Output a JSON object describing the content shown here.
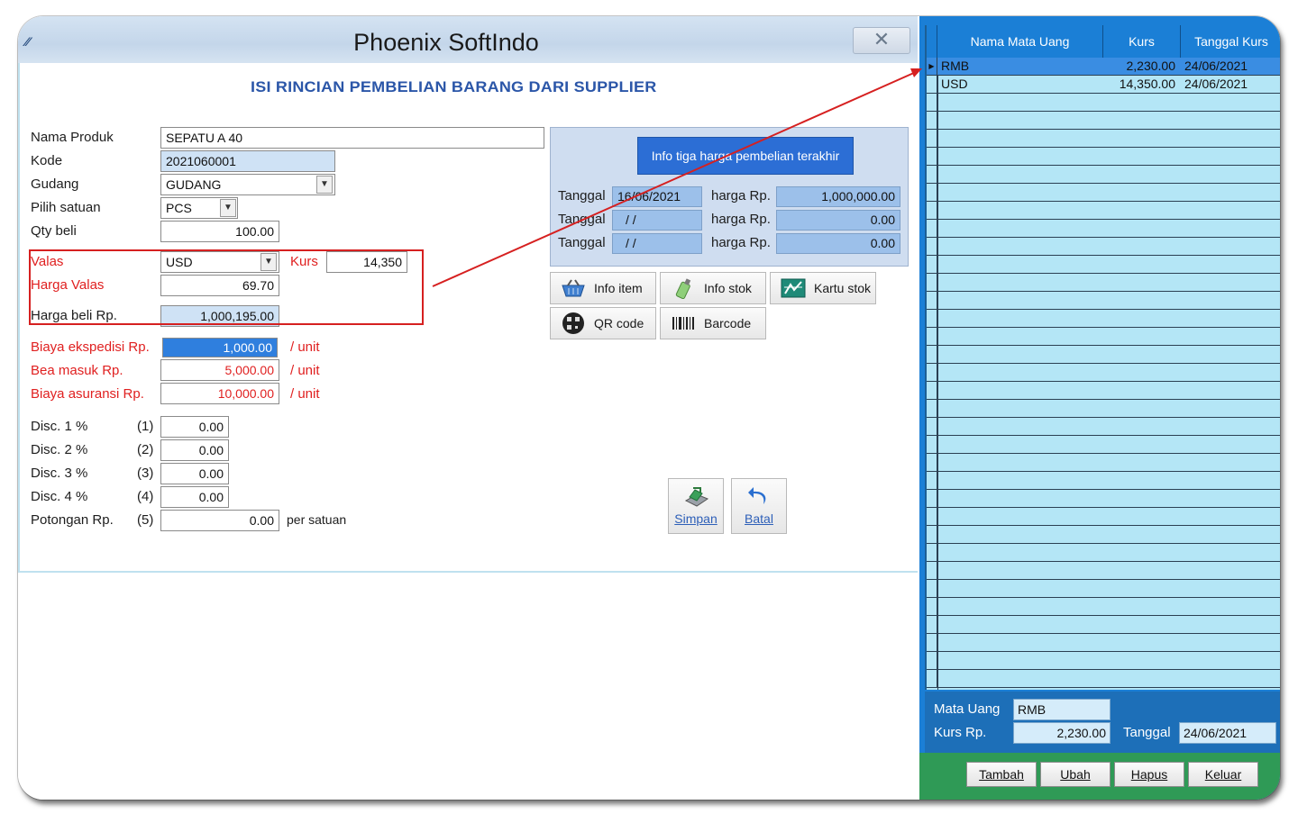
{
  "window": {
    "title": "Phoenix SoftIndo",
    "heading": "ISI RINCIAN PEMBELIAN BARANG DARI SUPPLIER"
  },
  "form": {
    "nama_produk": {
      "label": "Nama Produk",
      "value": "SEPATU A 40"
    },
    "kode": {
      "label": "Kode",
      "value": "2021060001"
    },
    "gudang": {
      "label": "Gudang",
      "value": "GUDANG"
    },
    "satuan": {
      "label": "Pilih satuan",
      "value": "PCS"
    },
    "qty": {
      "label": "Qty beli",
      "value": "100.00"
    },
    "valas": {
      "label": "Valas",
      "value": "USD"
    },
    "kurs": {
      "label": "Kurs",
      "value": "14,350"
    },
    "harga_valas": {
      "label": "Harga Valas",
      "value": "69.70"
    },
    "harga_beli": {
      "label": "Harga beli Rp.",
      "value": "1,000,195.00"
    },
    "biaya_ekspedisi": {
      "label": "Biaya ekspedisi Rp.",
      "value": "1,000.00",
      "unit": "/ unit"
    },
    "bea_masuk": {
      "label": "Bea masuk Rp.",
      "value": "5,000.00",
      "unit": "/ unit"
    },
    "biaya_asuransi": {
      "label": "Biaya asuransi Rp.",
      "value": "10,000.00",
      "unit": "/ unit"
    },
    "discounts": [
      {
        "label": "Disc. 1 %",
        "num": "(1)",
        "value": "0.00"
      },
      {
        "label": "Disc. 2 %",
        "num": "(2)",
        "value": "0.00"
      },
      {
        "label": "Disc. 3 %",
        "num": "(3)",
        "value": "0.00"
      },
      {
        "label": "Disc. 4 %",
        "num": "(4)",
        "value": "0.00"
      }
    ],
    "potongan": {
      "label": "Potongan Rp.",
      "num": "(5)",
      "value": "0.00",
      "unit": "per satuan"
    }
  },
  "info_panel": {
    "button_label": "Info tiga harga pembelian terakhir",
    "rows": [
      {
        "tanggal_label": "Tanggal",
        "tanggal": "16/06/2021",
        "harga_label": "harga Rp.",
        "harga": "1,000,000.00"
      },
      {
        "tanggal_label": "Tanggal",
        "tanggal": "/ /",
        "harga_label": "harga Rp.",
        "harga": "0.00"
      },
      {
        "tanggal_label": "Tanggal",
        "tanggal": "/ /",
        "harga_label": "harga Rp.",
        "harga": "0.00"
      }
    ]
  },
  "tool_buttons": {
    "info_item": "Info item",
    "info_stok": "Info stok",
    "kartu_stok": "Kartu stok",
    "qr_code": "QR code",
    "barcode": "Barcode"
  },
  "actions": {
    "simpan": "Simpan",
    "batal": "Batal"
  },
  "currency_grid": {
    "columns": [
      "Nama Mata Uang",
      "Kurs",
      "Tanggal Kurs"
    ],
    "rows": [
      {
        "nama": "RMB",
        "kurs": "2,230.00",
        "tanggal": "24/06/2021"
      },
      {
        "nama": "USD",
        "kurs": "14,350.00",
        "tanggal": "24/06/2021"
      }
    ],
    "indicator": "▶"
  },
  "currency_detail": {
    "mata_uang_label": "Mata Uang",
    "mata_uang": "RMB",
    "kurs_label": "Kurs Rp.",
    "kurs": "2,230.00",
    "tanggal_label": "Tanggal",
    "tanggal": "24/06/2021"
  },
  "footer_buttons": {
    "tambah": "Tambah",
    "ubah": "Ubah",
    "hapus": "Hapus",
    "keluar": "Keluar"
  },
  "colors": {
    "accent_blue": "#1b7fd6",
    "grid_bg": "#b4e6f6",
    "highlight_red": "#d62020",
    "footer_green": "#2f9a56"
  },
  "icons": [
    "app-icon",
    "close-icon",
    "basket-icon",
    "bottle-icon",
    "chart-icon",
    "qr-icon",
    "barcode-icon",
    "save-icon",
    "undo-icon"
  ]
}
